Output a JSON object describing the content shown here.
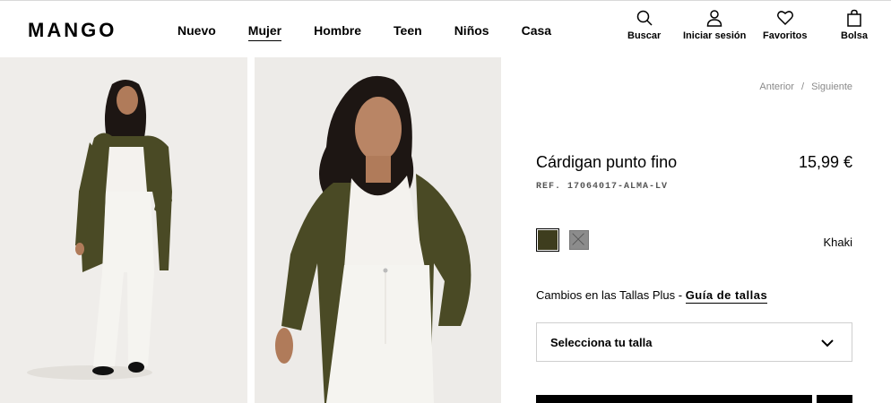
{
  "brand": {
    "logo": "MANGO"
  },
  "nav": [
    {
      "label": "Nuevo"
    },
    {
      "label": "Mujer",
      "active": true
    },
    {
      "label": "Hombre"
    },
    {
      "label": "Teen"
    },
    {
      "label": "Niños"
    },
    {
      "label": "Casa"
    }
  ],
  "tools": {
    "search": {
      "label": "Buscar",
      "icon": "search-icon"
    },
    "login": {
      "label": "Iniciar sesión",
      "icon": "user-icon"
    },
    "favorites": {
      "label": "Favoritos",
      "icon": "heart-icon"
    },
    "bag": {
      "label": "Bolsa",
      "icon": "bag-icon"
    }
  },
  "breadcrumb": {
    "prev": "Anterior",
    "separator": "/",
    "next": "Siguiente"
  },
  "product": {
    "name": "Cárdigan punto fino",
    "price": "15,99 €",
    "ref": "REF. 17064017-ALMA-LV",
    "selected_color": "Khaki",
    "colors": [
      {
        "hex": "#3e3d1e",
        "selected": true
      },
      {
        "hex": "#8c8c8c",
        "selected": false
      }
    ]
  },
  "sizes": {
    "plus_text": "Cambios en las Tallas Plus -",
    "guide_link": "Guía de tallas",
    "select_label": "Selecciona tu talla"
  },
  "colors": {
    "cardigan": "#4a4a25",
    "background": "#efedea",
    "text": "#000000",
    "muted": "#8a8a8a"
  }
}
